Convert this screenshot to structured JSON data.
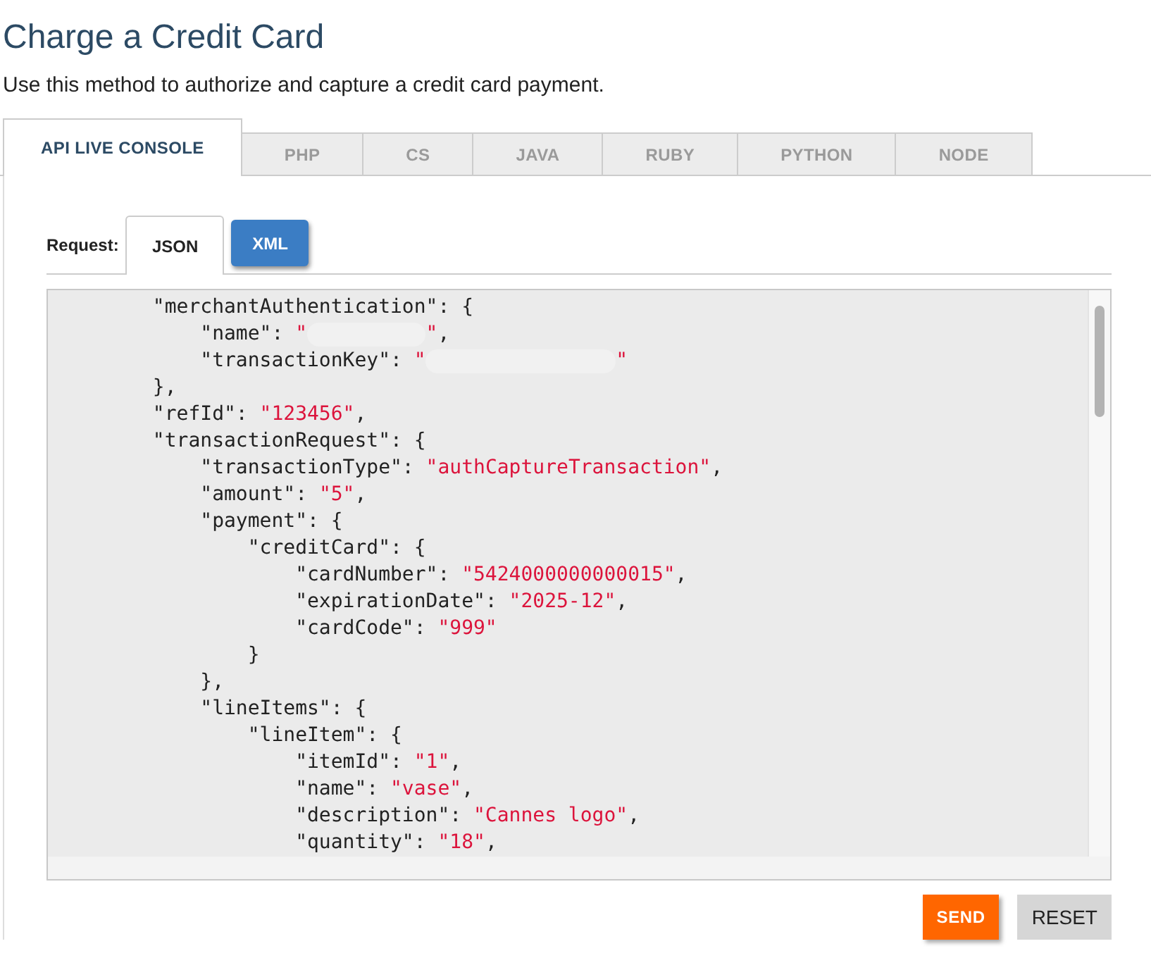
{
  "page": {
    "title": "Charge a Credit Card",
    "description": "Use this method to authorize and capture a credit card payment."
  },
  "tabs": [
    {
      "label": "API LIVE CONSOLE",
      "selected": true
    },
    {
      "label": "PHP",
      "selected": false
    },
    {
      "label": "CS",
      "selected": false
    },
    {
      "label": "JAVA",
      "selected": false
    },
    {
      "label": "RUBY",
      "selected": false
    },
    {
      "label": "PYTHON",
      "selected": false
    },
    {
      "label": "NODE",
      "selected": false
    }
  ],
  "request": {
    "label": "Request:",
    "formats": [
      {
        "label": "JSON",
        "selected": true
      },
      {
        "label": "XML",
        "selected": false
      }
    ]
  },
  "code": {
    "lines": [
      {
        "kind": "plain",
        "text": "\"merchantAuthentication\": {",
        "children": [
          {
            "kind": "masked",
            "text": "\"name\": ",
            "value": "\"",
            "value_end": "\"",
            "tail": ","
          },
          {
            "kind": "widemasked",
            "text": "\"transactionKey\": ",
            "value": "\"",
            "value_end": "\""
          }
        ],
        "end": "},"
      },
      {
        "kind": "plain",
        "text": "\"refId\": ",
        "value": "\"123456\"",
        "tail": ","
      },
      {
        "kind": "plain",
        "text": "\"transactionRequest\": {",
        "children": [
          {
            "kind": "plain",
            "text": "\"transactionType\": ",
            "value": "\"authCaptureTransaction\"",
            "tail": ","
          },
          {
            "kind": "plain",
            "text": "\"amount\": ",
            "value": "\"5\"",
            "tail": ","
          },
          {
            "kind": "plain",
            "text": "\"payment\": {",
            "children": [
              {
                "kind": "plain",
                "text": "\"creditCard\": {",
                "children": [
                  {
                    "kind": "plain",
                    "text": "\"cardNumber\": ",
                    "value": "\"5424000000000015\"",
                    "tail": ","
                  },
                  {
                    "kind": "plain",
                    "text": "\"expirationDate\": ",
                    "value": "\"2025-12\"",
                    "tail": ","
                  },
                  {
                    "kind": "plain",
                    "text": "\"cardCode\": ",
                    "value": "\"999\""
                  }
                ],
                "end": "}"
              }
            ],
            "end": "},"
          },
          {
            "kind": "plain",
            "text": "\"lineItems\": {",
            "children": [
              {
                "kind": "plain",
                "text": "\"lineItem\": {",
                "children": [
                  {
                    "kind": "plain",
                    "text": "\"itemId\": ",
                    "value": "\"1\"",
                    "tail": ","
                  },
                  {
                    "kind": "plain",
                    "text": "\"name\": ",
                    "value": "\"vase\"",
                    "tail": ","
                  },
                  {
                    "kind": "plain",
                    "text": "\"description\": ",
                    "value": "\"Cannes logo\"",
                    "tail": ","
                  },
                  {
                    "kind": "plain",
                    "text": "\"quantity\": ",
                    "value": "\"18\"",
                    "tail": ","
                  }
                ]
              }
            ]
          }
        ]
      }
    ]
  },
  "buttons": [
    {
      "label": "SEND",
      "kind": "primary"
    },
    {
      "label": "RESET",
      "kind": "secondary"
    }
  ]
}
